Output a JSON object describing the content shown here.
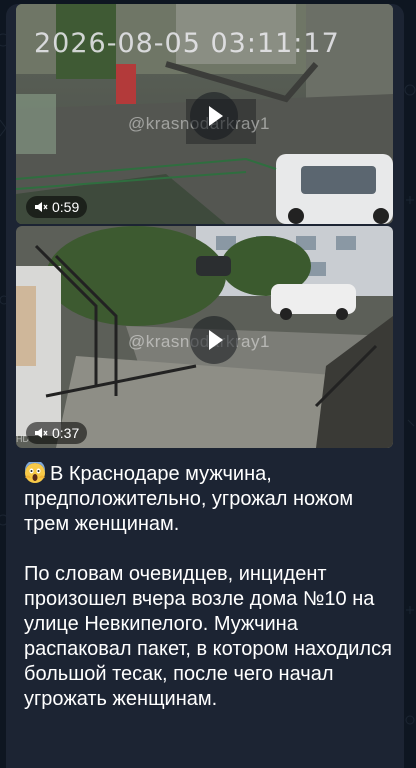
{
  "post": {
    "videos": [
      {
        "timestamp": "2026-08-05 03:11:17",
        "watermark": "@krasnodarkray1",
        "duration": "0:59"
      },
      {
        "timestamp": "",
        "watermark": "@krasnodarkray1",
        "duration": "0:37",
        "cctv_tag": "HD"
      }
    ],
    "emoji": "screaming-face",
    "headline": "В Краснодаре мужчина, предположительно, угрожал ножом трем женщинам.",
    "body": "По словам очевидцев, инцидент произошел вчера возле дома №10 на улице Невкипелого. Мужчина распаковал пакет, в котором находился большой тесак, после чего начал угрожать женщинам."
  },
  "colors": {
    "background": "#0e1621",
    "bubble": "#1c2433",
    "text": "#ffffff"
  }
}
